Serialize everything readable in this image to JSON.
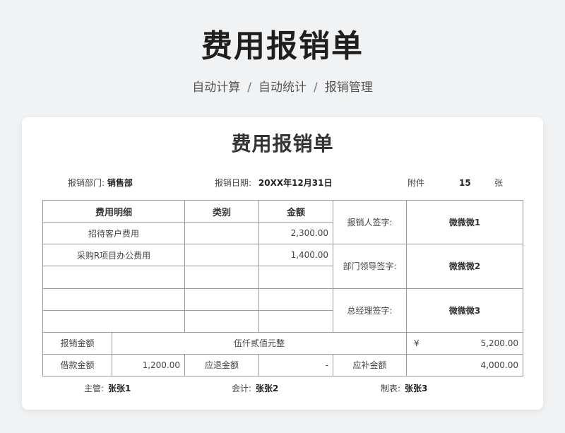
{
  "header": {
    "title": "费用报销单",
    "subtitle_items": [
      "自动计算",
      "自动统计",
      "报销管理"
    ],
    "separator": "/"
  },
  "form": {
    "title": "费用报销单",
    "department_label": "报销部门:",
    "department_value": "销售部",
    "date_label": "报销日期:",
    "date_value": "20XX年12月31日",
    "attachment_label": "附件",
    "attachment_count": "15",
    "attachment_unit": "张",
    "columns": {
      "detail": "费用明细",
      "category": "类别",
      "amount": "金额"
    },
    "rows": [
      {
        "detail": "招待客户费用",
        "category": "",
        "amount": "2,300.00"
      },
      {
        "detail": "采购R项目办公费用",
        "category": "",
        "amount": "1,400.00"
      },
      {
        "detail": "",
        "category": "",
        "amount": ""
      },
      {
        "detail": "",
        "category": "",
        "amount": ""
      },
      {
        "detail": "",
        "category": "",
        "amount": ""
      }
    ],
    "signatures": [
      {
        "label": "报销人签字:",
        "value": "微微微1"
      },
      {
        "label": "部门领导签字:",
        "value": "微微微2"
      },
      {
        "label": "总经理签字:",
        "value": "微微微3"
      }
    ],
    "total_label": "报销金额",
    "total_words": "伍仟贰佰元整",
    "currency_symbol": "¥",
    "total_amount": "5,200.00",
    "loan_label": "借款金额",
    "loan_amount": "1,200.00",
    "refund_label": "应退金额",
    "refund_amount": "-",
    "supplement_label": "应补金额",
    "supplement_amount": "4,000.00",
    "footer": {
      "supervisor_label": "主管:",
      "supervisor_value": "张张1",
      "accountant_label": "会计:",
      "accountant_value": "张张2",
      "preparer_label": "制表:",
      "preparer_value": "张张3"
    }
  }
}
